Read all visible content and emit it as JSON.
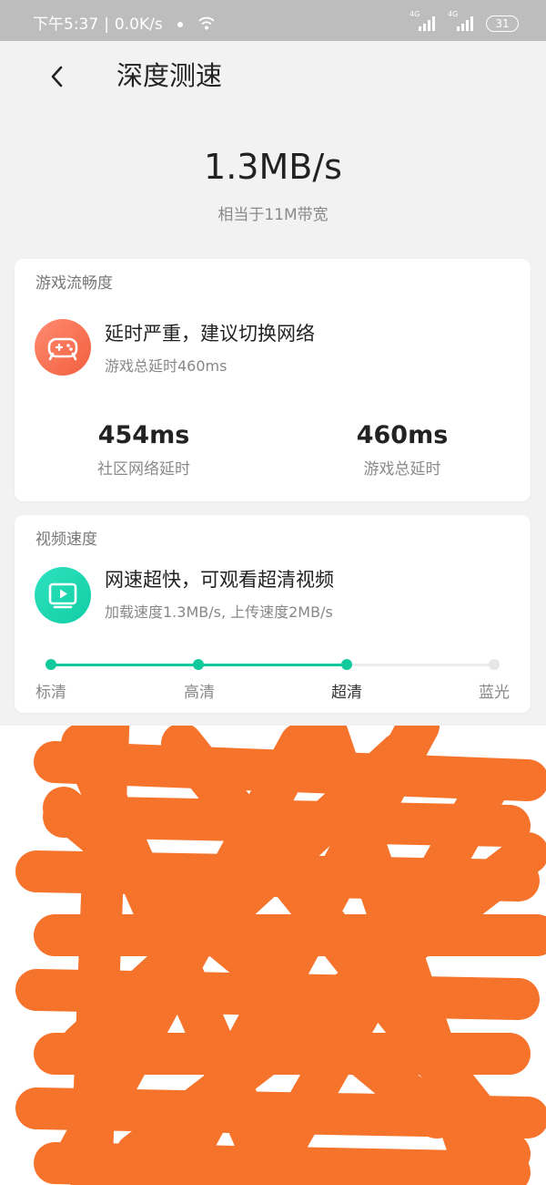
{
  "status_bar": {
    "time": "下午5:37",
    "separator": "|",
    "net_speed": "0.0K/s",
    "signal_1": "4G",
    "signal_2": "4G",
    "battery": "31"
  },
  "header": {
    "title": "深度测速"
  },
  "result": {
    "speed": "1.3MB/s",
    "equivalent": "相当于11M带宽"
  },
  "game_card": {
    "title": "游戏流畅度",
    "icon": "gamepad-icon",
    "message": "延时严重，建议切换网络",
    "detail": "游戏总延时460ms",
    "stats": [
      {
        "value": "454ms",
        "label": "社区网络延时"
      },
      {
        "value": "460ms",
        "label": "游戏总延时"
      }
    ]
  },
  "video_card": {
    "title": "视频速度",
    "icon": "play-icon",
    "message": "网速超快，可观看超清视频",
    "detail": "加载速度1.3MB/s, 上传速度2MB/s",
    "quality_levels": [
      "标清",
      "高清",
      "超清",
      "蓝光"
    ],
    "current_level_index": 2
  },
  "colors": {
    "accent": "#12c99b",
    "game_icon": "#f2603f",
    "scribble": "#f5732a"
  }
}
